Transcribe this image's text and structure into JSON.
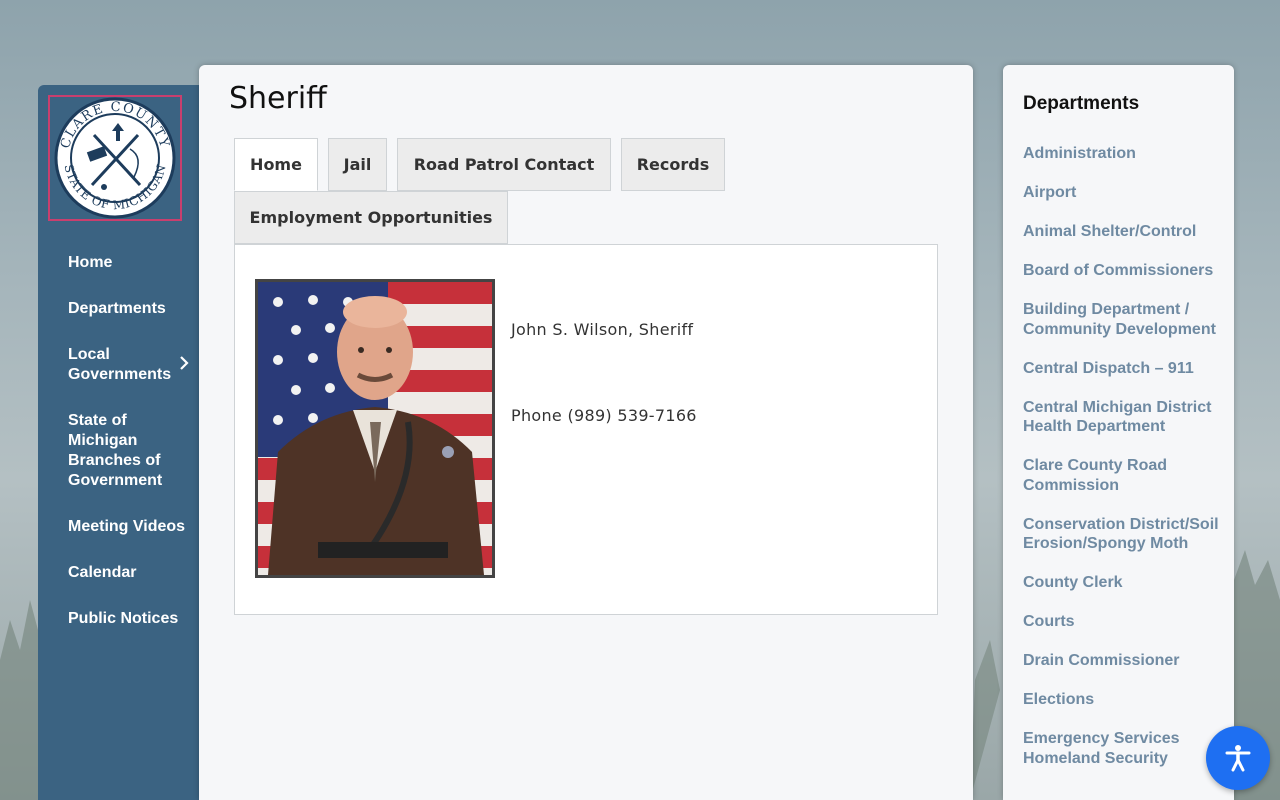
{
  "colors": {
    "sidebar_bg": "#3b6382",
    "logo_border": "#c93f6e",
    "dept_link": "#6f8aa2",
    "a11y_button": "#1e6ff2"
  },
  "logo": {
    "top_text": "CLARE COUNTY",
    "bottom_text": "STATE OF MICHIGAN"
  },
  "nav": {
    "items": [
      {
        "label": "Home"
      },
      {
        "label": "Departments"
      },
      {
        "label": "Local Governments",
        "icon": "chevron-right-icon"
      },
      {
        "label": "State of Michigan Branches of Government"
      },
      {
        "label": "Meeting Videos"
      },
      {
        "label": "Calendar"
      },
      {
        "label": "Public Notices"
      }
    ]
  },
  "page": {
    "title": "Sheriff",
    "tabs": [
      {
        "label": "Home",
        "active": true
      },
      {
        "label": "Jail"
      },
      {
        "label": "Road Patrol Contact"
      },
      {
        "label": "Records"
      },
      {
        "label": "Employment Opportunities"
      }
    ],
    "content": {
      "name_line": "John S. Wilson, Sheriff",
      "phone_line": "Phone (989) 539-7166"
    }
  },
  "departments": {
    "title": "Departments",
    "items": [
      "Administration",
      "Airport",
      "Animal Shelter/Control",
      "Board of Commissioners",
      "Building Department / Community Development",
      "Central Dispatch – 911",
      "Central Michigan District Health Department",
      "Clare County Road Commission",
      "Conservation District/Soil Erosion/Spongy Moth",
      "County Clerk",
      "Courts",
      "Drain Commissioner",
      "Elections",
      "Emergency Services Homeland Security"
    ]
  },
  "accessibility": {
    "icon": "accessibility-icon"
  }
}
